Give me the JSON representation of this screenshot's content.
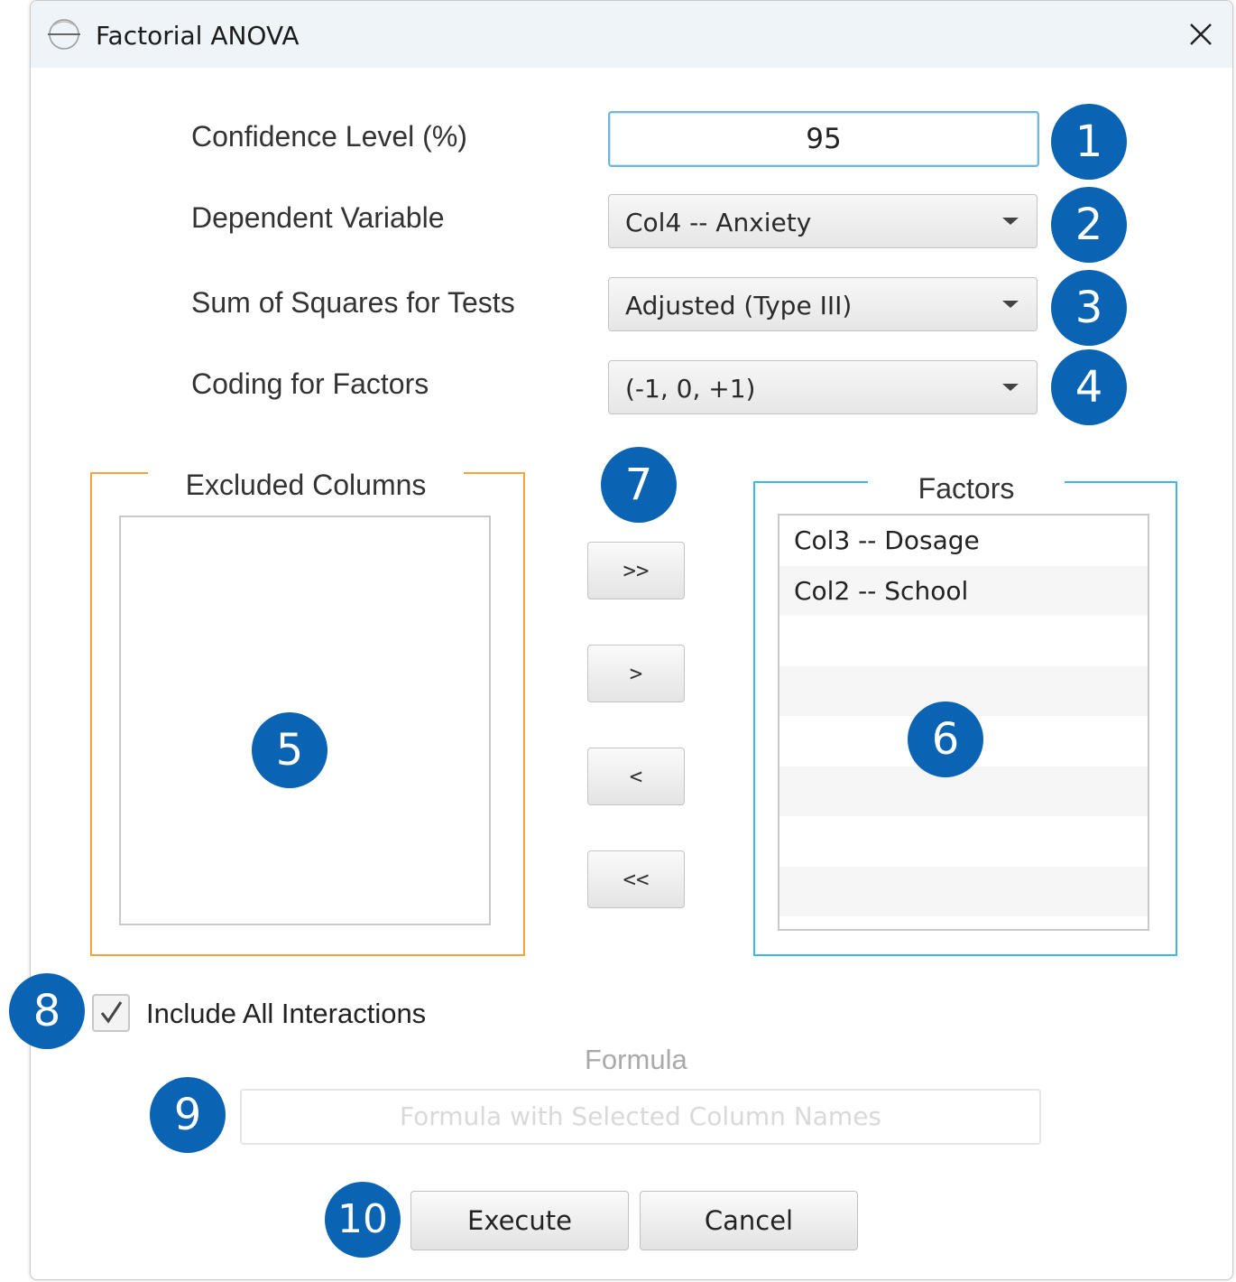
{
  "window": {
    "title": "Factorial ANOVA",
    "icon": "app-logo-icon",
    "close_icon": "close-icon"
  },
  "form": {
    "confidence_label": "Confidence Level (%)",
    "confidence_value": "95",
    "dependent_label": "Dependent Variable",
    "dependent_value": "Col4 -- Anxiety",
    "sumsq_label": "Sum of Squares for Tests",
    "sumsq_value": "Adjusted (Type III)",
    "coding_label": "Coding for Factors",
    "coding_value": "(-1, 0, +1)"
  },
  "excluded": {
    "title": "Excluded Columns",
    "items": [],
    "color": "#f5a33a"
  },
  "factors": {
    "title": "Factors",
    "items": [
      "Col3 -- Dosage",
      "Col2 -- School"
    ],
    "color": "#3bb8e8"
  },
  "move_buttons": {
    "add_all": ">>",
    "add_one": ">",
    "remove_one": "<",
    "remove_all": "<<"
  },
  "interactions": {
    "label": "Include All Interactions",
    "checked": true
  },
  "formula": {
    "title": "Formula",
    "placeholder": "Formula with Selected Column Names"
  },
  "actions": {
    "execute": "Execute",
    "cancel": "Cancel"
  },
  "badges": [
    "1",
    "2",
    "3",
    "4",
    "5",
    "6",
    "7",
    "8",
    "9",
    "10"
  ],
  "badge_color": "#0a63b3"
}
